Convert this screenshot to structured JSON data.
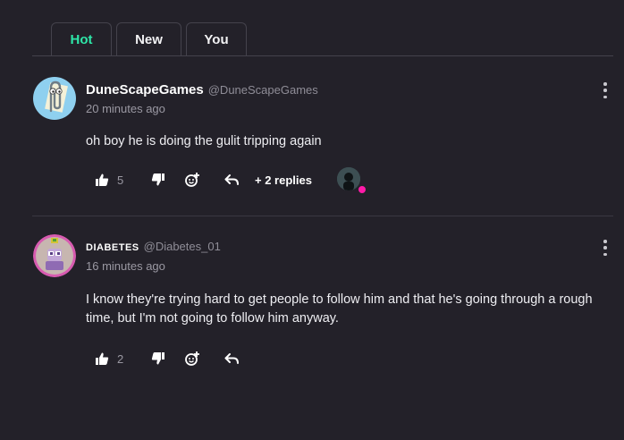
{
  "tabs": [
    {
      "label": "Hot",
      "active": true
    },
    {
      "label": "New",
      "active": false
    },
    {
      "label": "You",
      "active": false
    }
  ],
  "comments": [
    {
      "name": "DuneScapeGames",
      "handle": "@DuneScapeGames",
      "time": "20 minutes ago",
      "text": "oh boy he is doing the gulit tripping again",
      "likes": "5",
      "replies": "+ 2 replies",
      "avatar_icon": "paperclip-avatar"
    },
    {
      "name": "DIABETES",
      "handle": "@Diabetes_01",
      "time": "16 minutes ago",
      "text": "I know they're trying hard to get people to follow him and that he's going through a rough time, but I'm not going to follow him anyway.",
      "likes": "2",
      "avatar_icon": "character-avatar"
    }
  ],
  "colors": {
    "background": "#232129",
    "active_tab": "#2ee6a8",
    "online_badge": "#ff1aa8"
  }
}
